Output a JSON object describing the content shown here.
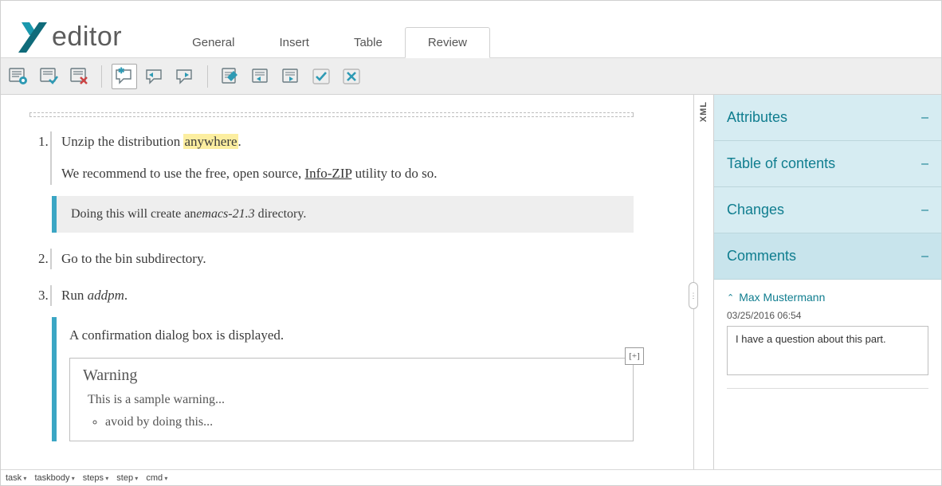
{
  "app": {
    "name": "Xeditor",
    "logo_text": "editor"
  },
  "menu": {
    "tabs": [
      {
        "label": "General",
        "active": false
      },
      {
        "label": "Insert",
        "active": false
      },
      {
        "label": "Table",
        "active": false
      },
      {
        "label": "Review",
        "active": true
      }
    ]
  },
  "toolbar": {
    "buttons": [
      {
        "name": "track-changes-settings-icon"
      },
      {
        "name": "accept-all-changes-icon"
      },
      {
        "name": "reject-all-changes-icon"
      },
      {
        "sep": true
      },
      {
        "name": "new-comment-icon",
        "selected": true
      },
      {
        "name": "previous-comment-icon"
      },
      {
        "name": "next-comment-icon"
      },
      {
        "sep": true
      },
      {
        "name": "edit-change-icon"
      },
      {
        "name": "previous-change-icon"
      },
      {
        "name": "next-change-icon"
      },
      {
        "name": "accept-change-icon"
      },
      {
        "name": "reject-change-icon"
      }
    ]
  },
  "document": {
    "steps": [
      {
        "text_pre": "Unzip the distribution ",
        "highlighted": "anywhere",
        "text_post": ".",
        "sub": {
          "line_pre": "We recommend to use the free, open source,  ",
          "link_text": "Info-ZIP",
          "line_post": "  utility to do so."
        },
        "info": {
          "pre": "Doing this will create an",
          "em": "emacs-21.3",
          "post": " directory."
        }
      },
      {
        "text": "Go to the bin subdirectory."
      },
      {
        "text_pre": "Run ",
        "em": "addpm",
        "text_post": ".",
        "note": "A confirmation dialog box is displayed.",
        "warning": {
          "title": "Warning",
          "text": "This is a sample warning...",
          "bullets": [
            "avoid by doing this..."
          ],
          "expand": "[+]"
        }
      }
    ]
  },
  "side_tab": {
    "label": "XML"
  },
  "sidebar": {
    "panels": [
      {
        "label": "Attributes"
      },
      {
        "label": "Table of contents"
      },
      {
        "label": "Changes"
      },
      {
        "label": "Comments",
        "expanded": true
      }
    ],
    "comment": {
      "author": "Max Mustermann",
      "timestamp": "03/25/2016 06:54",
      "body": "I have a question about this part."
    }
  },
  "footer": {
    "crumbs": [
      "task",
      "taskbody",
      "steps",
      "step",
      "cmd"
    ]
  }
}
